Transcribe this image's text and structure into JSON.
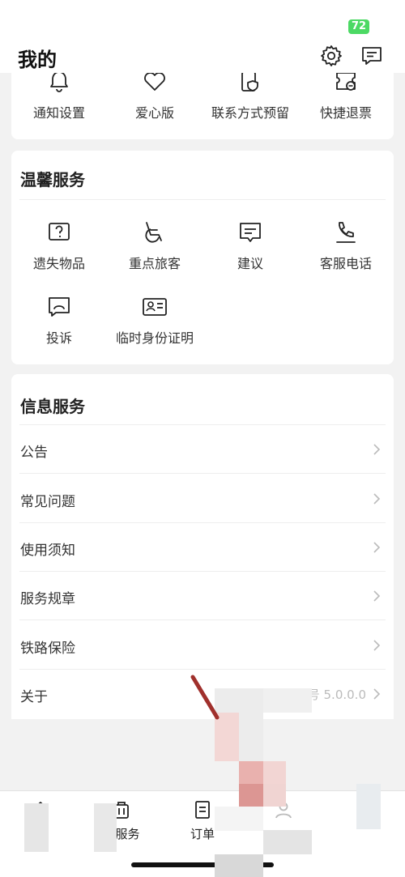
{
  "status_bar": {
    "battery": "72"
  },
  "header": {
    "title": "我的"
  },
  "top_shortcuts": [
    {
      "label": "通知设置",
      "icon": "bell-icon"
    },
    {
      "label": "爱心版",
      "icon": "heart-icon"
    },
    {
      "label": "联系方式预留",
      "icon": "phone-shield-icon"
    },
    {
      "label": "快捷退票",
      "icon": "ticket-refund-icon"
    }
  ],
  "warm_service": {
    "title": "温馨服务",
    "items": [
      {
        "label": "遗失物品",
        "icon": "question-box-icon"
      },
      {
        "label": "重点旅客",
        "icon": "wheelchair-icon"
      },
      {
        "label": "建议",
        "icon": "chat-bubble-icon"
      },
      {
        "label": "客服电话",
        "icon": "phone-icon"
      },
      {
        "label": "投诉",
        "icon": "complaint-icon"
      },
      {
        "label": "临时身份证明",
        "icon": "id-card-icon"
      }
    ]
  },
  "info_service": {
    "title": "信息服务",
    "rows": [
      {
        "label": "公告"
      },
      {
        "label": "常见问题"
      },
      {
        "label": "使用须知"
      },
      {
        "label": "服务规章"
      },
      {
        "label": "铁路保险"
      },
      {
        "label": "关于",
        "value": "版本号 5.0.0.0"
      }
    ]
  },
  "tab_bar": {
    "items": [
      {
        "label": "",
        "icon": "home-icon"
      },
      {
        "label": "行服务",
        "icon": "travel-service-icon"
      },
      {
        "label": "订单",
        "icon": "order-icon"
      },
      {
        "label": "",
        "icon": "profile-icon"
      }
    ]
  },
  "colors": {
    "battery_green": "#4cd964",
    "annotation_red": "#a0302c"
  }
}
